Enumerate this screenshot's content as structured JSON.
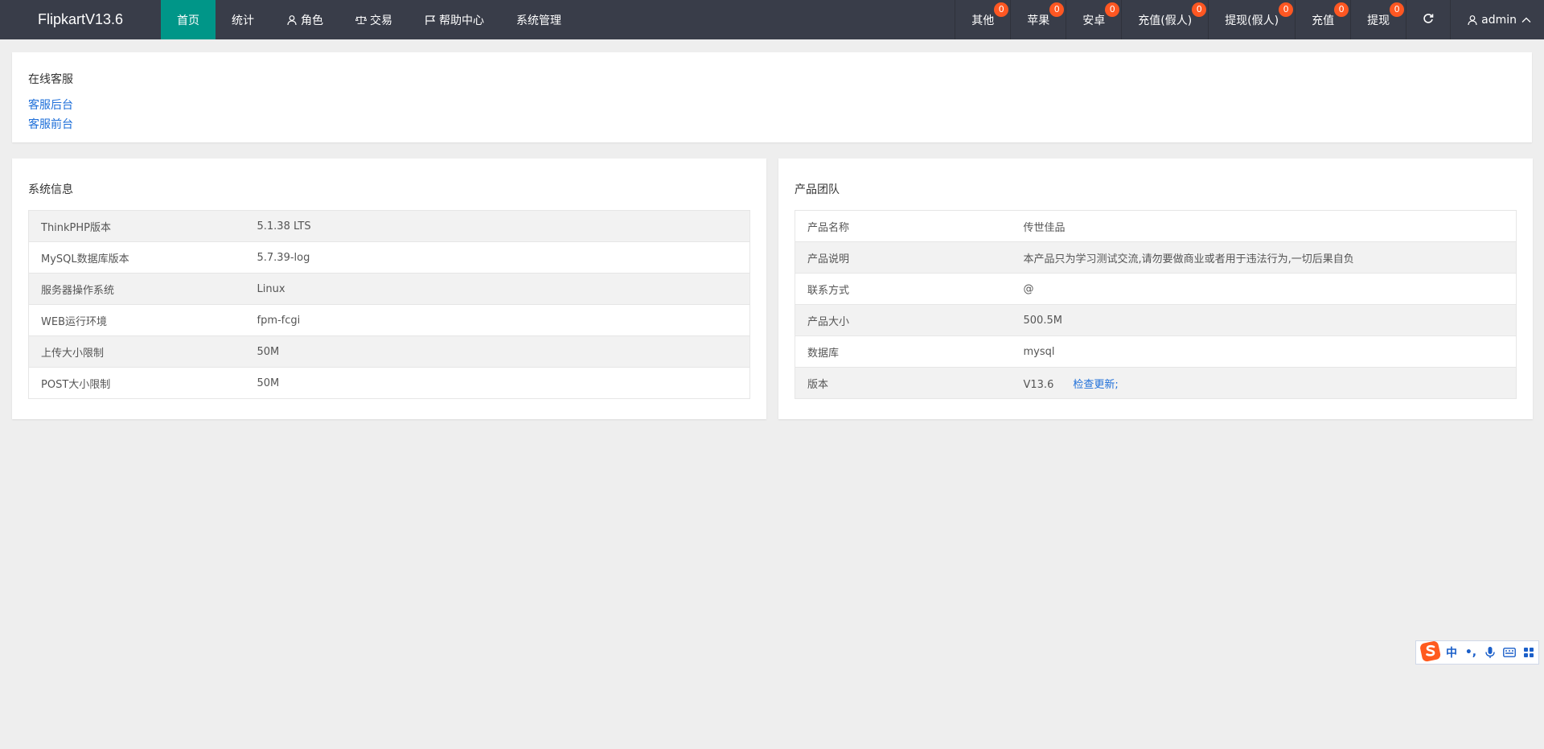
{
  "header": {
    "logo": "FlipkartV13.6",
    "nav": [
      {
        "label": "首页",
        "icon": "none"
      },
      {
        "label": "统计",
        "icon": "none"
      },
      {
        "label": "角色",
        "icon": "user-icon"
      },
      {
        "label": "交易",
        "icon": "scale-icon"
      },
      {
        "label": "帮助中心",
        "icon": "flag-icon"
      },
      {
        "label": "系统管理",
        "icon": "none"
      }
    ],
    "right": [
      {
        "label": "其他",
        "badge": "0"
      },
      {
        "label": "苹果",
        "badge": "0"
      },
      {
        "label": "安卓",
        "badge": "0"
      },
      {
        "label": "充值(假人)",
        "badge": "0"
      },
      {
        "label": "提现(假人)",
        "badge": "0"
      },
      {
        "label": "充值",
        "badge": "0"
      },
      {
        "label": "提现",
        "badge": "0"
      }
    ],
    "user": "admin"
  },
  "service": {
    "title": "在线客服",
    "link_backend": "客服后台",
    "link_frontend": "客服前台"
  },
  "system": {
    "title": "系统信息",
    "rows": [
      {
        "key": "ThinkPHP版本",
        "value": "5.1.38 LTS"
      },
      {
        "key": "MySQL数据库版本",
        "value": "5.7.39-log"
      },
      {
        "key": "服务器操作系统",
        "value": "Linux"
      },
      {
        "key": "WEB运行环境",
        "value": "fpm-fcgi"
      },
      {
        "key": "上传大小限制",
        "value": "50M"
      },
      {
        "key": "POST大小限制",
        "value": "50M"
      }
    ]
  },
  "product": {
    "title": "产品团队",
    "rows": [
      {
        "key": "产品名称",
        "value": "传世佳品"
      },
      {
        "key": "产品说明",
        "value": "本产品只为学习测试交流,请勿要做商业或者用于违法行为,一切后果自负"
      },
      {
        "key": "联系方式",
        "value": "@"
      },
      {
        "key": "产品大小",
        "value": "500.5M"
      },
      {
        "key": "数据库",
        "value": "mysql"
      },
      {
        "key": "版本",
        "value": "V13.6"
      }
    ],
    "update_label": "检查更新;"
  },
  "ime": {
    "mode": "中",
    "punct": "•,"
  },
  "colors": {
    "header_bg": "#393d49",
    "active_nav": "#009688",
    "badge": "#ff5722",
    "link": "#1e6fd9"
  }
}
